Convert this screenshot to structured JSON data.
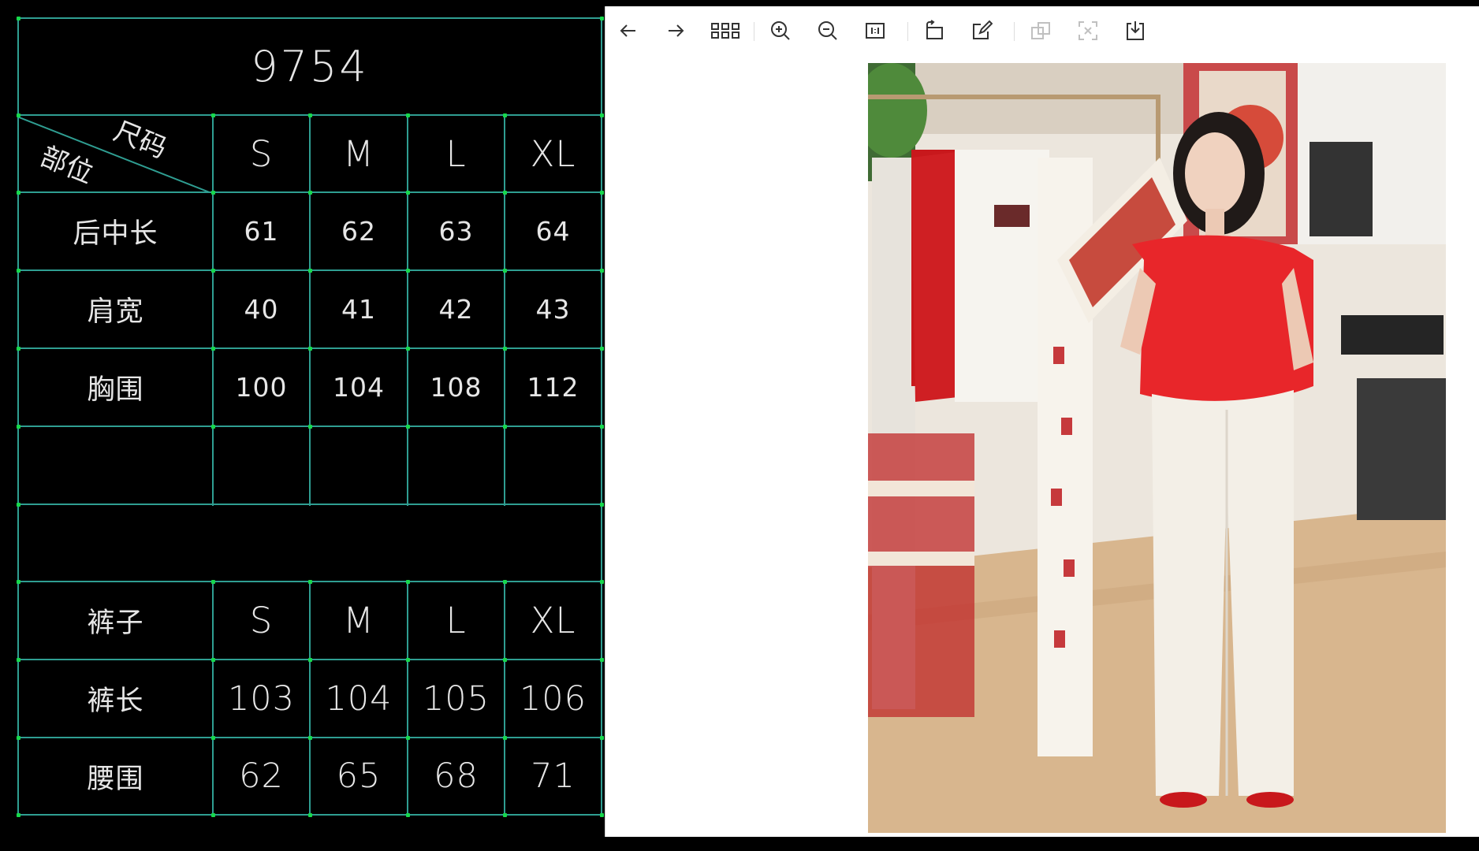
{
  "table": {
    "title": "9754",
    "header": {
      "size_label": "尺码",
      "part_label": "部位",
      "sizes": [
        "S",
        "M",
        "L",
        "XL"
      ]
    },
    "top_rows": [
      {
        "label": "后中长",
        "values": [
          "61",
          "62",
          "63",
          "64"
        ]
      },
      {
        "label": "肩宽",
        "values": [
          "40",
          "41",
          "42",
          "43"
        ]
      },
      {
        "label": "胸围",
        "values": [
          "100",
          "104",
          "108",
          "112"
        ]
      }
    ],
    "pants_header": {
      "label": "裤子",
      "sizes": [
        "S",
        "M",
        "L",
        "XL"
      ]
    },
    "pants_rows": [
      {
        "label": "裤长",
        "values": [
          "103",
          "104",
          "105",
          "106"
        ]
      },
      {
        "label": "腰围",
        "values": [
          "62",
          "65",
          "68",
          "71"
        ]
      }
    ]
  },
  "toolbar": {
    "buttons": [
      {
        "name": "back-button",
        "icon": "arrow-left-icon"
      },
      {
        "name": "forward-button",
        "icon": "arrow-right-icon"
      },
      {
        "name": "grid-view-button",
        "icon": "grid-icon"
      },
      {
        "name": "zoom-in-button",
        "icon": "zoom-in-icon"
      },
      {
        "name": "zoom-out-button",
        "icon": "zoom-out-icon"
      },
      {
        "name": "actual-size-button",
        "icon": "actual-size-icon"
      },
      {
        "name": "rotate-button",
        "icon": "rotate-icon"
      },
      {
        "name": "edit-button",
        "icon": "edit-icon"
      },
      {
        "name": "copy-button",
        "icon": "copy-icon",
        "disabled": true
      },
      {
        "name": "ocr-button",
        "icon": "ocr-icon",
        "disabled": true
      },
      {
        "name": "download-button",
        "icon": "download-icon"
      }
    ]
  },
  "photo": {
    "subject": "photo-model-in-red-top-and-white-pants"
  },
  "colors": {
    "grid_line": "#2f9e92",
    "node": "#17d84c",
    "text": "#e6e6e6",
    "top_red": "#e8262a"
  }
}
